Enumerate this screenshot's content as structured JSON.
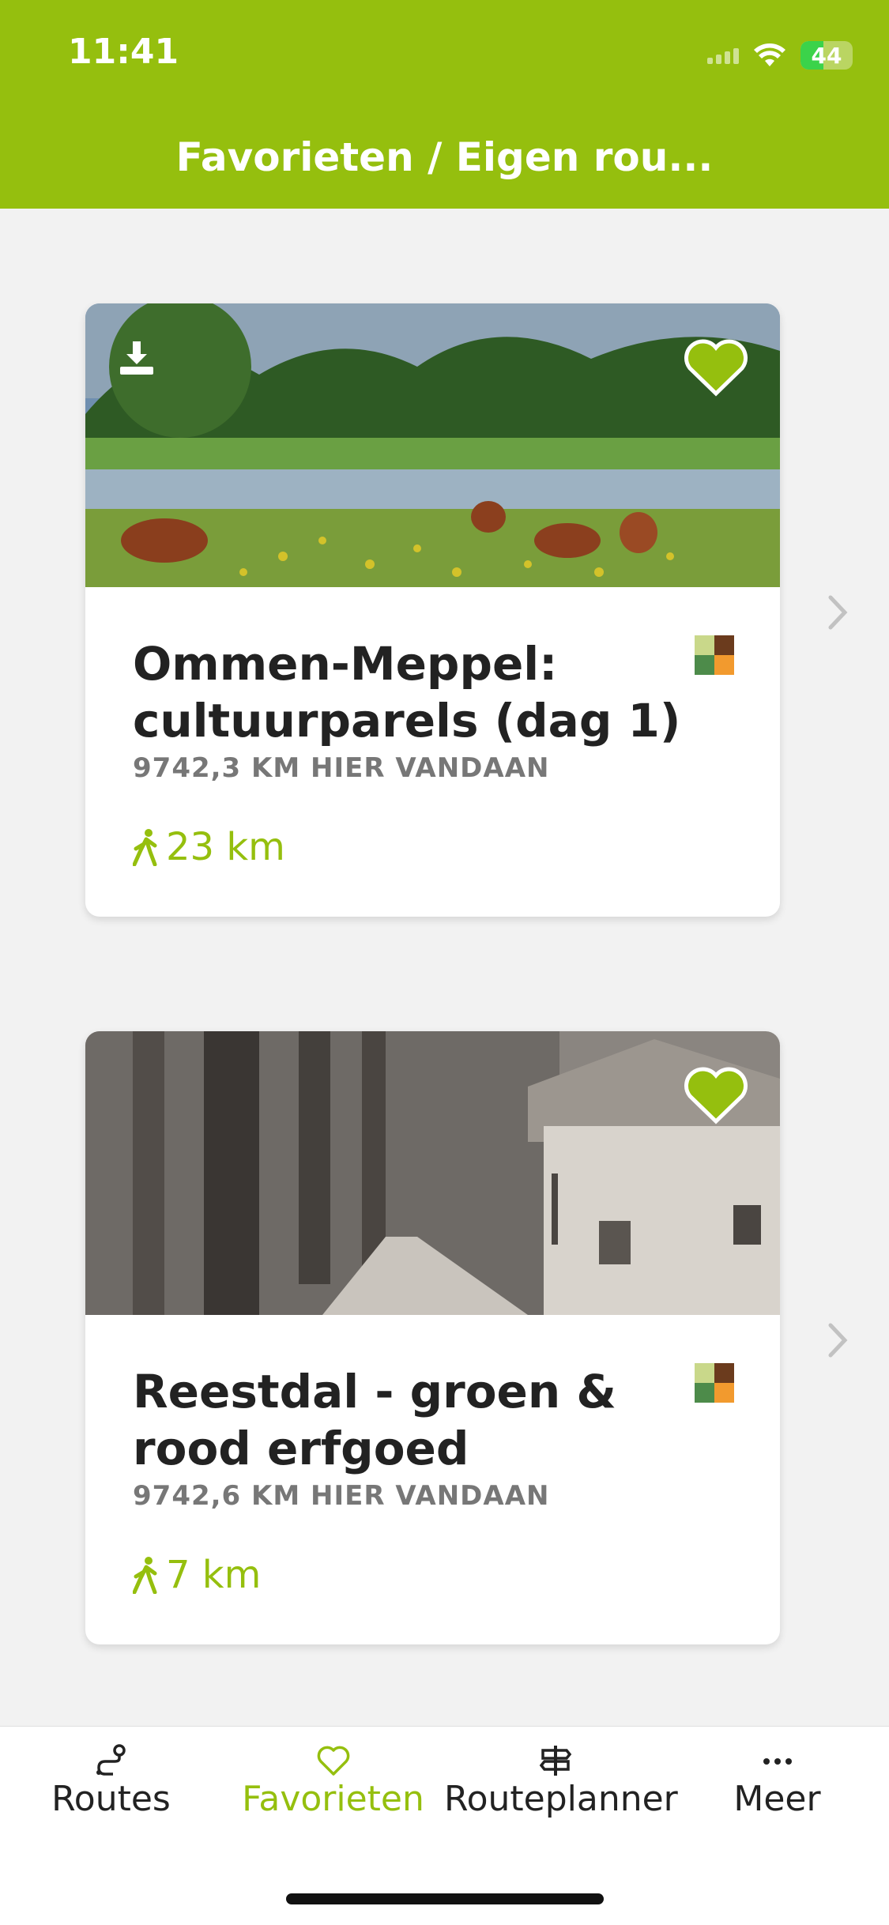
{
  "status_bar": {
    "time": "11:41",
    "battery": "44"
  },
  "header": {
    "title": "Favorieten / Eigen rou..."
  },
  "routes": [
    {
      "title": "Ommen-Meppel: cultuurparels (dag 1)",
      "distance_away": "9742,3 KM HIER VANDAAN",
      "length": "23 km",
      "favorited": true,
      "downloaded": true
    },
    {
      "title": "Reestdal - groen & rood erfgoed",
      "distance_away": "9742,6 KM HIER VANDAAN",
      "length": "7 km",
      "favorited": true,
      "downloaded": false
    }
  ],
  "tabbar": {
    "items": [
      {
        "label": "Routes",
        "icon": "route-icon",
        "active": false
      },
      {
        "label": "Favorieten",
        "icon": "heart-icon",
        "active": true
      },
      {
        "label": "Routeplanner",
        "icon": "signpost-icon",
        "active": false
      },
      {
        "label": "Meer",
        "icon": "more-dots-icon",
        "active": false
      }
    ]
  },
  "colors": {
    "accent": "#95bf0e",
    "background": "#f2f2f2"
  }
}
